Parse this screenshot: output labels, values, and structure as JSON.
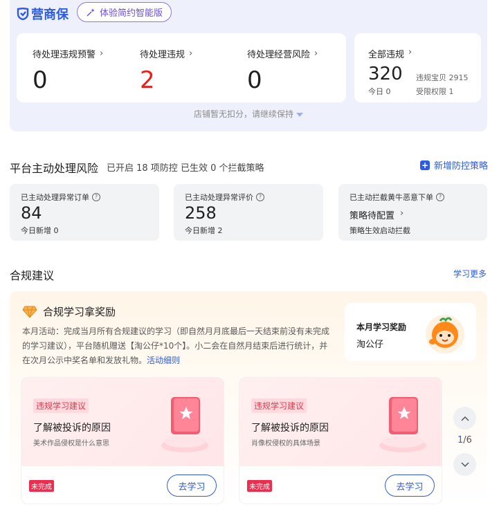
{
  "header": {
    "logo_text": "营商保",
    "smart_button_label": "体验简约智能版"
  },
  "violations": {
    "pending_warning": {
      "label": "待处理违规预警",
      "value": "0"
    },
    "pending_violation": {
      "label": "待处理违规",
      "value": "2"
    },
    "pending_risk": {
      "label": "待处理经营风险",
      "value": "0"
    },
    "all": {
      "label": "全部违规",
      "value": "320",
      "today": "今日 0",
      "items": [
        "违规宝贝 2915",
        "受限权限 1"
      ]
    },
    "tip": "店铺暂无扣分，请继续保持"
  },
  "risk": {
    "title": "平台主动处理风险",
    "subtitle": "已开启 18 项防控 已生效 0 个拦截策略",
    "add_label": "新增防控策略",
    "cards": [
      {
        "label": "已主动处理异常订单",
        "value": "84",
        "today": "今日新增 0"
      },
      {
        "label": "已主动处理异常评价",
        "value": "258",
        "today": "今日新增 2"
      },
      {
        "label": "已主动拦截黄牛恶意下单",
        "pending": "策略待配置",
        "note": "策略生效启动拦截"
      }
    ]
  },
  "compliance": {
    "title": "合规建议",
    "learn_more": "学习更多",
    "award_title": "合规学习拿奖励",
    "award_desc": "本月活动：完成当月所有合规建议的学习（即自然月月底最后一天结束前没有未完成的学习建议），平台随机赠送【淘公仔*10个】。小二会在自然月结束后进行统计，并在次月公示中奖名单和发放礼物。",
    "award_link": "活动细则",
    "reward_title": "本月学习奖励",
    "reward_name": "淘公仔",
    "cards": [
      {
        "tag": "违规学习建议",
        "title": "了解被投诉的原因",
        "subtitle": "美术作品侵权是什么意思",
        "status": "未完成",
        "button": "去学习"
      },
      {
        "tag": "违规学习建议",
        "title": "了解被投诉的原因",
        "subtitle": "肖像权侵权的具体场景",
        "status": "未完成",
        "button": "去学习"
      }
    ],
    "pager": {
      "current": "1",
      "total": "/6"
    }
  },
  "colors": {
    "accent": "#2d5be3",
    "danger": "#e8201a",
    "tag": "#e23a4c"
  }
}
